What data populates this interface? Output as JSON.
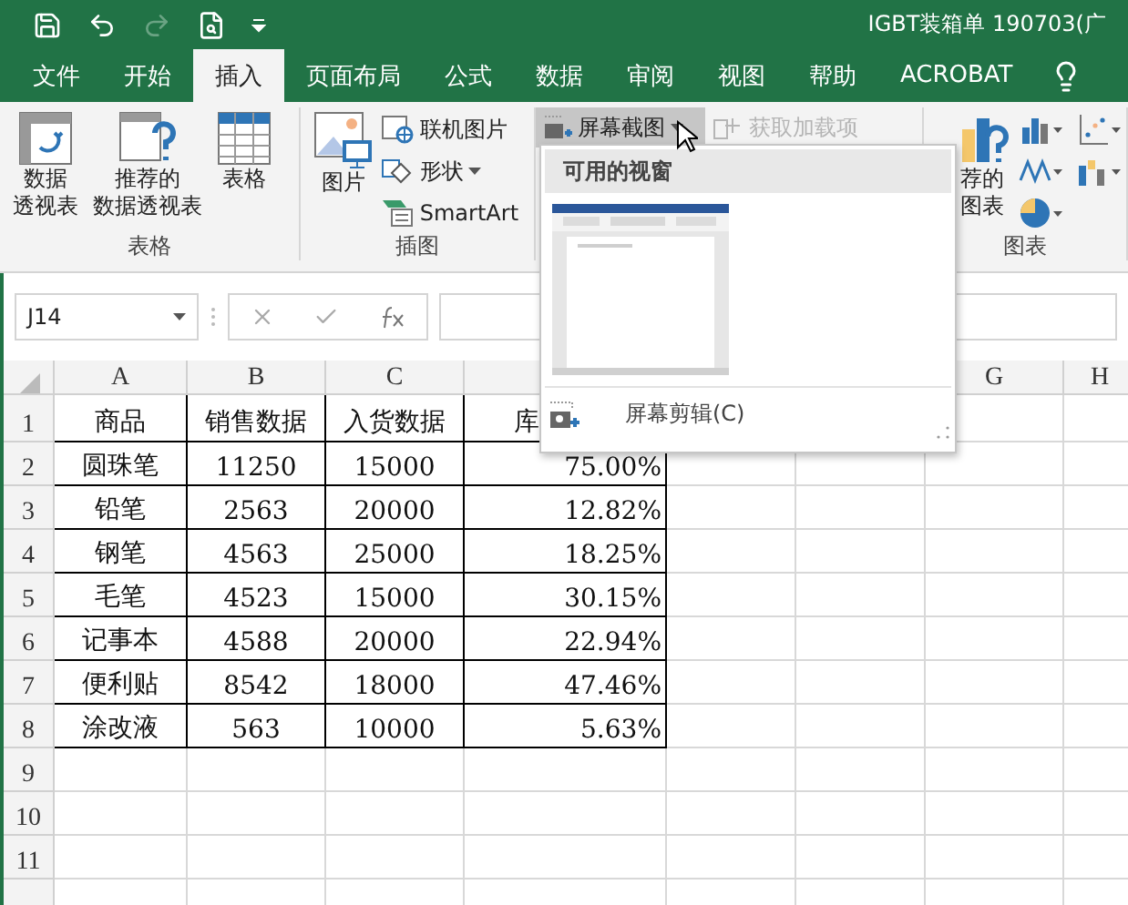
{
  "title_bar": {
    "title": "IGBT装箱单 190703(广",
    "quick_access": [
      {
        "kind": "save",
        "disabled": false
      },
      {
        "kind": "undo",
        "disabled": false
      },
      {
        "kind": "redo",
        "disabled": true
      },
      {
        "kind": "preview",
        "disabled": false
      },
      {
        "kind": "customize",
        "disabled": false
      }
    ]
  },
  "tabs": [
    {
      "label": "文件",
      "selected": false
    },
    {
      "label": "开始",
      "selected": false
    },
    {
      "label": "插入",
      "selected": true
    },
    {
      "label": "页面布局",
      "selected": false
    },
    {
      "label": "公式",
      "selected": false
    },
    {
      "label": "数据",
      "selected": false
    },
    {
      "label": "审阅",
      "selected": false
    },
    {
      "label": "视图",
      "selected": false
    },
    {
      "label": "帮助",
      "selected": false
    },
    {
      "label": "ACROBAT",
      "selected": false
    }
  ],
  "ribbon": {
    "table_group": {
      "label": "表格",
      "buttons": [
        {
          "kind": "pivot",
          "lines": [
            "数据",
            "透视表"
          ]
        },
        {
          "kind": "recommended_pivot",
          "lines": [
            "推荐的",
            "数据透视表"
          ]
        },
        {
          "kind": "table",
          "lines": [
            "表格"
          ]
        }
      ]
    },
    "illustrations_group": {
      "label": "插图",
      "picture": {
        "lines": [
          "图片"
        ]
      },
      "small_buttons": [
        {
          "kind": "online_picture",
          "label": "联机图片",
          "caret": false
        },
        {
          "kind": "shapes",
          "label": "形状",
          "caret": true
        },
        {
          "kind": "smartart",
          "label": "SmartArt",
          "caret": false
        }
      ]
    },
    "screenshot_button": {
      "label": "屏幕截图",
      "pressed": true
    },
    "addins_button": {
      "label": "获取加载项",
      "disabled": true
    },
    "charts_group": {
      "label": "图表",
      "recommended": {
        "lines": [
          "荐的",
          "图表"
        ]
      }
    }
  },
  "formula_bar": {
    "name_box": "J14"
  },
  "sheet": {
    "columns": [
      {
        "label": "A"
      },
      {
        "label": "B"
      },
      {
        "label": "C"
      },
      {},
      {},
      {},
      {
        "label": "G"
      },
      {
        "label": "H"
      }
    ],
    "rows": [
      {
        "number": "1",
        "cells": [
          "商品",
          "销售数据",
          "入货数据",
          "库"
        ]
      },
      {
        "number": "2",
        "cells": [
          "圆珠笔",
          "11250",
          "15000",
          "75.00%"
        ]
      },
      {
        "number": "3",
        "cells": [
          "铅笔",
          "2563",
          "20000",
          "12.82%"
        ]
      },
      {
        "number": "4",
        "cells": [
          "钢笔",
          "4563",
          "25000",
          "18.25%"
        ]
      },
      {
        "number": "5",
        "cells": [
          "毛笔",
          "4523",
          "15000",
          "30.15%"
        ]
      },
      {
        "number": "6",
        "cells": [
          "记事本",
          "4588",
          "20000",
          "22.94%"
        ]
      },
      {
        "number": "7",
        "cells": [
          "便利贴",
          "8542",
          "18000",
          "47.46%"
        ]
      },
      {
        "number": "8",
        "cells": [
          "涂改液",
          "563",
          "10000",
          "5.63%"
        ]
      },
      {
        "number": "9"
      },
      {
        "number": "10"
      },
      {
        "number": "11"
      }
    ]
  },
  "screenshot_menu": {
    "heading": "可用的视窗",
    "items": [
      {
        "label": "屏幕剪辑(C)"
      }
    ]
  }
}
